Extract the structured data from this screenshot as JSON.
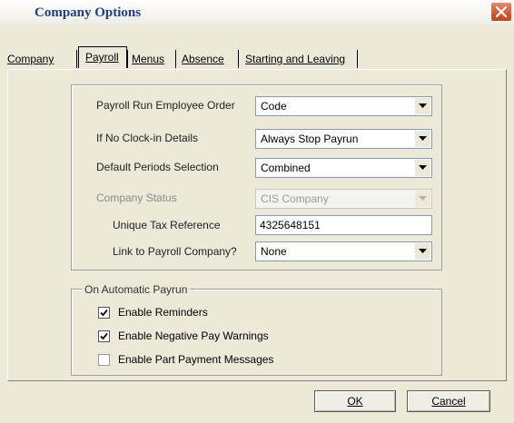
{
  "window": {
    "title": "Company Options"
  },
  "tabs": [
    {
      "label": "Company"
    },
    {
      "label": "Payroll"
    },
    {
      "label": "Menus"
    },
    {
      "label": "Absence"
    },
    {
      "label": "Starting and Leaving"
    }
  ],
  "payroll": {
    "run_order_label": "Payroll Run Employee Order",
    "run_order_value": "Code",
    "no_clock_label": "If No Clock-in Details",
    "no_clock_value": "Always Stop Payrun",
    "periods_label": "Default Periods Selection",
    "periods_value": "Combined",
    "status_label": "Company Status",
    "status_value": "CIS Company",
    "utr_label": "Unique Tax Reference",
    "utr_value": "4325648151",
    "link_label": "Link to Payroll Company?",
    "link_value": "None"
  },
  "auto_payrun": {
    "legend": "On Automatic Payrun",
    "options": [
      {
        "label": "Enable Reminders",
        "checked": true
      },
      {
        "label": "Enable Negative Pay Warnings",
        "checked": true
      },
      {
        "label": "Enable Part Payment Messages",
        "checked": false
      }
    ]
  },
  "buttons": {
    "ok": "OK",
    "cancel": "Cancel"
  }
}
